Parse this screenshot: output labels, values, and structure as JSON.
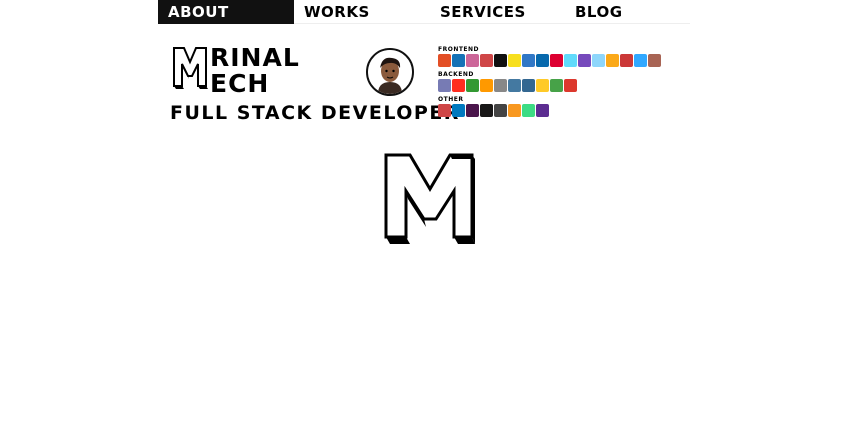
{
  "nav": {
    "items": [
      {
        "label": "ABOUT",
        "active": true
      },
      {
        "label": "WORKS",
        "active": false
      },
      {
        "label": "SERVICES",
        "active": false
      },
      {
        "label": "BLOG",
        "active": false
      }
    ]
  },
  "profile": {
    "name_line1": "RINAL",
    "name_line2": "ECH",
    "role": "FULL STACK DEVELOPER",
    "avatar_icon": "avatar-portrait"
  },
  "stack": {
    "frontend_label": "FRONTEND",
    "backend_label": "BACKEND",
    "other_label": "OTHER",
    "frontend": [
      {
        "icon": "html5-icon",
        "color": "#e34f26",
        "text": "5"
      },
      {
        "icon": "css3-icon",
        "color": "#1572b6",
        "text": "3"
      },
      {
        "icon": "sass-icon",
        "color": "#cc6699",
        "text": "S"
      },
      {
        "icon": "gulp-icon",
        "color": "#cf4647",
        "text": "G"
      },
      {
        "icon": "bootstrap-icon",
        "color": "#111111",
        "text": "B"
      },
      {
        "icon": "javascript-icon",
        "color": "#f7df1e",
        "text": "JS"
      },
      {
        "icon": "typescript-icon",
        "color": "#3178c6",
        "text": "TS"
      },
      {
        "icon": "jquery-icon",
        "color": "#0769ad",
        "text": "jQ"
      },
      {
        "icon": "angular-icon",
        "color": "#dd0031",
        "text": "A"
      },
      {
        "icon": "react-icon",
        "color": "#61dafb",
        "text": "⚛"
      },
      {
        "icon": "redux-icon",
        "color": "#764abc",
        "text": "R"
      },
      {
        "icon": "webpack-icon",
        "color": "#8ed6fb",
        "text": "W"
      },
      {
        "icon": "grunt-icon",
        "color": "#fba919",
        "text": "G"
      },
      {
        "icon": "npm-icon",
        "color": "#cb3837",
        "text": "n"
      },
      {
        "icon": "photoshop-icon",
        "color": "#31a8ff",
        "text": "Ps"
      },
      {
        "icon": "pug-icon",
        "color": "#a86454",
        "text": "P"
      }
    ],
    "backend": [
      {
        "icon": "php-icon",
        "color": "#777bb4",
        "text": "php"
      },
      {
        "icon": "laravel-icon",
        "color": "#ff2d20",
        "text": "L"
      },
      {
        "icon": "nodejs-icon",
        "color": "#339933",
        "text": "N"
      },
      {
        "icon": "aws-icon",
        "color": "#ff9900",
        "text": "AWS"
      },
      {
        "icon": "express-icon",
        "color": "#888888",
        "text": "ex"
      },
      {
        "icon": "mysql-icon",
        "color": "#4479a1",
        "text": "SQL"
      },
      {
        "icon": "postgresql-icon",
        "color": "#336791",
        "text": "PG"
      },
      {
        "icon": "firebase-icon",
        "color": "#ffca28",
        "text": "F"
      },
      {
        "icon": "mongodb-icon",
        "color": "#47a248",
        "text": "M"
      },
      {
        "icon": "redis-icon",
        "color": "#dc382d",
        "text": "R"
      }
    ],
    "other": [
      {
        "icon": "gulp-alt-icon",
        "color": "#cf4647",
        "text": "g"
      },
      {
        "icon": "trello-icon",
        "color": "#0079bf",
        "text": "T"
      },
      {
        "icon": "slack-icon",
        "color": "#4a154b",
        "text": "#"
      },
      {
        "icon": "github-icon",
        "color": "#181717",
        "text": "GH"
      },
      {
        "icon": "unity-icon",
        "color": "#444444",
        "text": "U"
      },
      {
        "icon": "java-icon",
        "color": "#f89820",
        "text": "J"
      },
      {
        "icon": "android-icon",
        "color": "#3ddc84",
        "text": "A"
      },
      {
        "icon": "visualstudio-icon",
        "color": "#5c2d91",
        "text": "VS"
      }
    ]
  }
}
